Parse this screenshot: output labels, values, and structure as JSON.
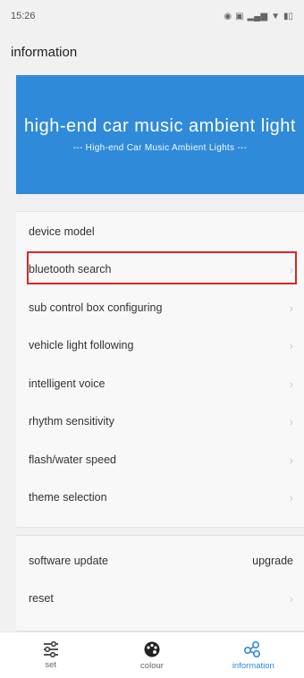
{
  "status": {
    "time": "15:26"
  },
  "header": {
    "title": "information"
  },
  "banner": {
    "title": "high-end car music ambient light",
    "subtitle": "--- High-end Car Music Ambient Lights ---"
  },
  "settings": {
    "items": [
      {
        "label": "device model"
      },
      {
        "label": "bluetooth search"
      },
      {
        "label": "sub control box configuring"
      },
      {
        "label": "vehicle light following"
      },
      {
        "label": "intelligent voice"
      },
      {
        "label": "rhythm sensitivity"
      },
      {
        "label": "flash/water speed"
      },
      {
        "label": "theme selection"
      }
    ]
  },
  "system": {
    "items": [
      {
        "label": "software update",
        "value": "upgrade"
      },
      {
        "label": "reset"
      }
    ]
  },
  "nav": {
    "items": [
      {
        "label": "set",
        "icon": "sliders-icon"
      },
      {
        "label": "colour",
        "icon": "palette-icon"
      },
      {
        "label": "information",
        "icon": "share-nodes-icon"
      }
    ],
    "active": "information",
    "accent": "#2f8ad9"
  },
  "colors": {
    "banner": "#2f8ad9",
    "highlight": "#e02424"
  }
}
